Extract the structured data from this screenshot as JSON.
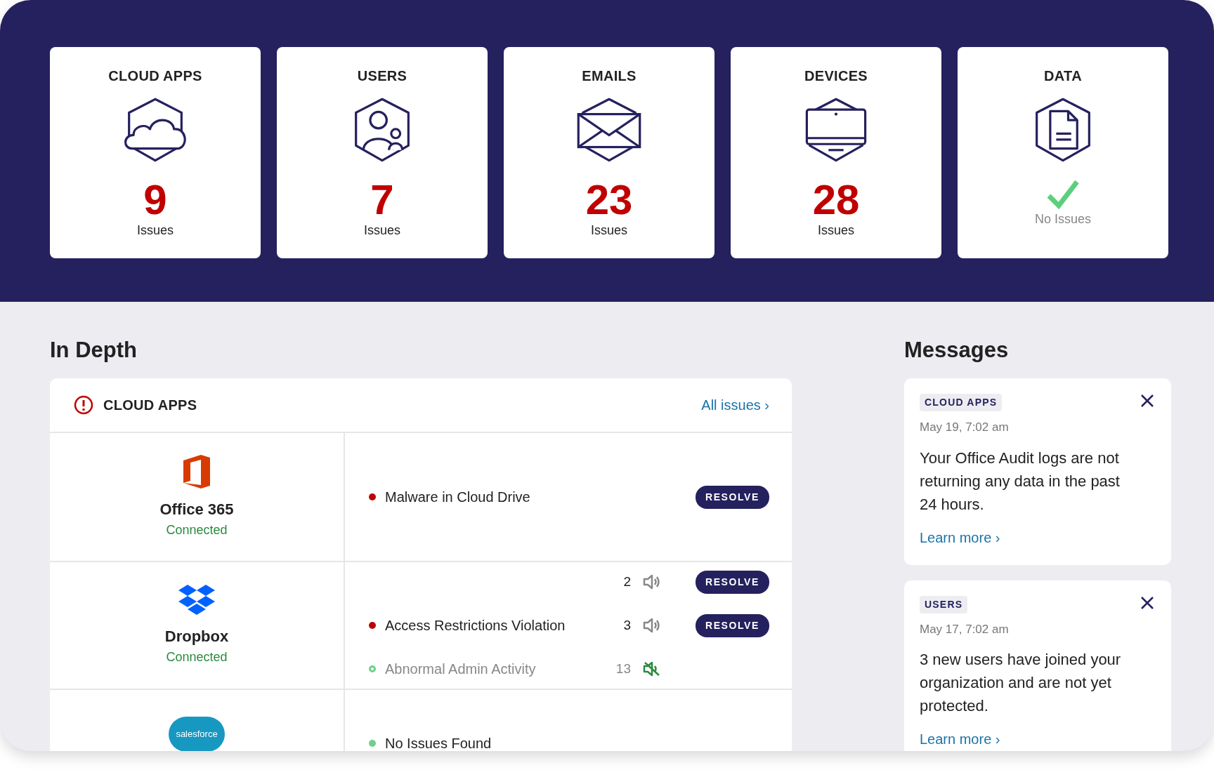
{
  "categories": [
    {
      "title": "CLOUD APPS",
      "kind": "issues",
      "count": "9",
      "caption": "Issues"
    },
    {
      "title": "USERS",
      "kind": "issues",
      "count": "7",
      "caption": "Issues"
    },
    {
      "title": "EMAILS",
      "kind": "issues",
      "count": "23",
      "caption": "Issues"
    },
    {
      "title": "DEVICES",
      "kind": "issues",
      "count": "28",
      "caption": "Issues"
    },
    {
      "title": "DATA",
      "kind": "ok",
      "caption": "No Issues"
    }
  ],
  "in_depth": {
    "heading": "In Depth",
    "section_title": "CLOUD APPS",
    "link": "All issues ›",
    "apps": [
      {
        "name": "Office 365",
        "status": "Connected",
        "issues": [
          {
            "label": "Malware in Cloud Drive",
            "kind": "alert",
            "action": "RESOLVE"
          }
        ]
      },
      {
        "name": "Dropbox",
        "status": "Connected",
        "issues": [
          {
            "kind": "alert",
            "count": "2",
            "muted": false,
            "action": "RESOLVE"
          },
          {
            "label": "Access Restrictions Violation",
            "kind": "alert",
            "count": "3",
            "muted": false,
            "action": "RESOLVE"
          },
          {
            "label": "Abnormal Admin Activity",
            "kind": "dismissed",
            "count": "13",
            "muted": true
          }
        ]
      },
      {
        "logo_text": "salesforce",
        "issues": [
          {
            "label": "No Issues Found",
            "kind": "clear"
          }
        ]
      }
    ]
  },
  "messages": {
    "heading": "Messages",
    "items": [
      {
        "tag": "CLOUD APPS",
        "date": "May 19, 7:02 am",
        "body": "Your Office Audit logs are not returning any data in the past 24 hours.",
        "link": "Learn more ›"
      },
      {
        "tag": "USERS",
        "date": "May 17, 7:02 am",
        "body": "3 new users have joined your organization and are not yet protected.",
        "link": "Learn more ›"
      }
    ]
  }
}
